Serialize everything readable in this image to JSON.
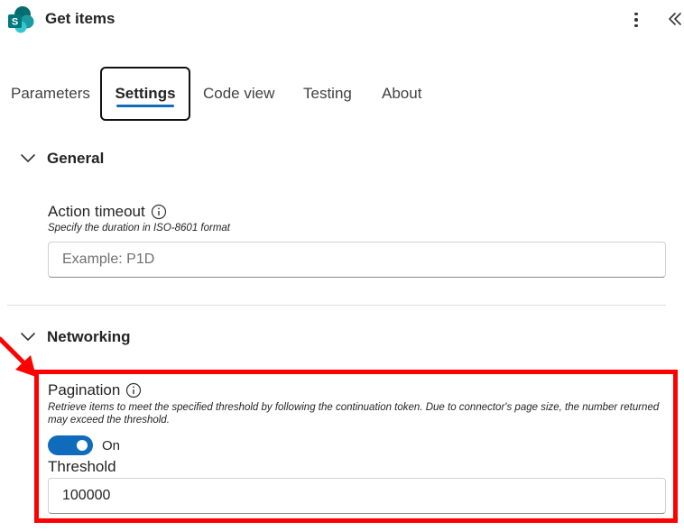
{
  "header": {
    "title": "Get items",
    "logo_icon": "sharepoint-logo-icon",
    "more_icon": "more-vertical-icon",
    "collapse_icon": "double-chevron-left-icon"
  },
  "tabs": [
    {
      "label": "Parameters",
      "selected": false
    },
    {
      "label": "Settings",
      "selected": true
    },
    {
      "label": "Code view",
      "selected": false
    },
    {
      "label": "Testing",
      "selected": false
    },
    {
      "label": "About",
      "selected": false
    }
  ],
  "sections": {
    "general": {
      "title": "General",
      "expanded": true,
      "action_timeout": {
        "label": "Action timeout",
        "description": "Specify the duration in ISO-8601 format",
        "placeholder": "Example: P1D",
        "value": ""
      }
    },
    "networking": {
      "title": "Networking",
      "expanded": true,
      "pagination": {
        "label": "Pagination",
        "description": "Retrieve items to meet the specified threshold by following the continuation token. Due to connector's page size, the number returned may exceed the threshold.",
        "toggle_state": "On",
        "enabled": true
      },
      "threshold": {
        "label": "Threshold",
        "value": "100000"
      }
    }
  },
  "colors": {
    "accent": "#0f6cbd",
    "annotation": "#ff0000",
    "text": "#242424"
  }
}
